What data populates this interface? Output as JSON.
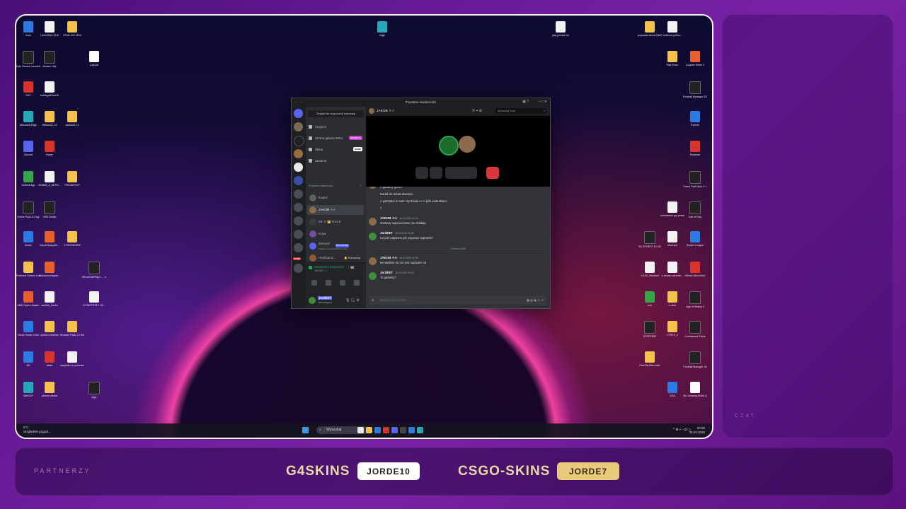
{
  "overlay": {
    "chat_label": "CZAT",
    "partners_label": "PARTNERZY",
    "partners": [
      {
        "brand": "G4SKINS",
        "code": "JORDE10",
        "pill_bg": "#ffffff",
        "pill_fg": "#222222"
      },
      {
        "brand": "CSGO-SKINS",
        "code": "JORDE7",
        "pill_bg": "#e9c97a",
        "pill_fg": "#3a2a10"
      }
    ]
  },
  "desktop": {
    "icons": [
      {
        "label": "Kosz",
        "type": "g-blue"
      },
      {
        "label": "LibreOffice 25.8",
        "type": "g-file"
      },
      {
        "label": "HTML-GO 2024",
        "type": "g-folder"
      },
      {
        "label": "edge",
        "type": "g-teal"
      },
      {
        "label": "jasy poczta me",
        "type": "g-file"
      },
      {
        "label": "poprawki strona BleSA",
        "type": "g-folder"
      },
      {
        "label": "zrobione-poliso...",
        "type": "g-file"
      },
      {
        "label": "Epic Games Launcher",
        "type": "g-dark"
      },
      {
        "label": "Mosaic Link",
        "type": "g-dark"
      },
      {
        "label": "CapCut",
        "type": "g-white"
      },
      {
        "label": "Pad Rozm",
        "type": "g-folder"
      },
      {
        "label": "Counter-Strike 2",
        "type": "g-orange"
      },
      {
        "label": "SKC",
        "type": "g-red"
      },
      {
        "label": "hostingofDirectX",
        "type": "g-file"
      },
      {
        "label": "Football Manager 2024",
        "type": "g-dark"
      },
      {
        "label": "Microsoft Edge",
        "type": "g-teal"
      },
      {
        "label": "efficiency 1.6",
        "type": "g-folder"
      },
      {
        "label": "windows 11",
        "type": "g-folder"
      },
      {
        "label": "Fortnite",
        "type": "g-blue"
      },
      {
        "label": "Discord",
        "type": "g-purple"
      },
      {
        "label": "Brave",
        "type": "g-red"
      },
      {
        "label": "Rockstar",
        "type": "g-red"
      },
      {
        "label": "NVIDIA App",
        "type": "g-green"
      },
      {
        "label": "9225B2_4_DEPO...",
        "type": "g-file"
      },
      {
        "label": "PROJEKTKP",
        "type": "g-folder"
      },
      {
        "label": "Grand Theft Auto V Legacy",
        "type": "g-dark"
      },
      {
        "label": "Online Pack S.Csgi",
        "type": "g-dark"
      },
      {
        "label": "OBS Studio",
        "type": "g-dark"
      },
      {
        "label": "Call of Duty",
        "type": "g-dark"
      },
      {
        "label": "hostowanie gry serwer",
        "type": "g-file"
      },
      {
        "label": "Steam",
        "type": "g-blue"
      },
      {
        "label": "KarperKarpyMo...",
        "type": "g-orange"
      },
      {
        "label": "ETHOSSHOW",
        "type": "g-folder"
      },
      {
        "label": "EA SPORTS FC 26",
        "type": "g-dark"
      },
      {
        "label": "efoot.pol",
        "type": "g-file"
      },
      {
        "label": "Rocket League",
        "type": "g-blue"
      },
      {
        "label": "Rockstar Games Launcher",
        "type": "g-folder"
      },
      {
        "label": "AktualnosZapyta...",
        "type": "g-orange"
      },
      {
        "label": "EthosRolePlay.n... - kopia",
        "type": "g-dark"
      },
      {
        "label": "c1102_efoot.pol",
        "type": "g-file"
      },
      {
        "label": "z-dewon-naumek...",
        "type": "g-file"
      },
      {
        "label": "Hitman Absolution",
        "type": "g-red"
      },
      {
        "label": "AMD Ryzen Master",
        "type": "g-orange"
      },
      {
        "label": "surefire_fincke",
        "type": "g-file"
      },
      {
        "label": "5.FINSTEST2 LG...",
        "type": "g-file"
      },
      {
        "label": "rme",
        "type": "g-green"
      },
      {
        "label": "c-dave",
        "type": "g-folder"
      },
      {
        "label": "Age of History 3",
        "type": "g-dark"
      },
      {
        "label": "Visual Studio Code",
        "type": "g-blue"
      },
      {
        "label": "system-vehicles",
        "type": "g-folder"
      },
      {
        "label": "Browser Pack 1.2 Beta wersja",
        "type": "g-folder"
      },
      {
        "label": "STEESS03",
        "type": "g-dark"
      },
      {
        "label": "CTRLS_2",
        "type": "g-folder"
      },
      {
        "label": "Contraband Police",
        "type": "g-dark"
      },
      {
        "label": "EA",
        "type": "g-blue"
      },
      {
        "label": "skala",
        "type": "g-red"
      },
      {
        "label": "wszystko co potrzebne ...",
        "type": "g-file"
      },
      {
        "label": "FiveObj-files-main",
        "type": "g-folder"
      },
      {
        "label": "Football Manager 26",
        "type": "g-dark"
      },
      {
        "label": "WinSCP",
        "type": "g-teal"
      },
      {
        "label": "obrone wirtice",
        "type": "g-folder"
      },
      {
        "label": "logo",
        "type": "g-dark"
      },
      {
        "label": "DSA",
        "type": "g-blue"
      },
      {
        "label": "Ski Jumping World Cup",
        "type": "g-white"
      }
    ]
  },
  "taskbar": {
    "weather_temp": "5°C",
    "weather_desc": "Względnie pogod...",
    "search_placeholder": "Wyszukaj",
    "clock_time": "20:55",
    "clock_date": "30.03.2025",
    "tray": "^  ⊕  ◐  ◁)  ▭"
  },
  "discord": {
    "window_title": "Prywatne wiadomości",
    "find_label": "Znajdź lub rozpocznij rozmowę",
    "nav": [
      {
        "label": "Znajomi"
      },
      {
        "label": "Strona główna Nitro",
        "badge": "NADZIEJA"
      },
      {
        "label": "Sklep",
        "badge": "NOWE"
      },
      {
        "label": "Zadania"
      }
    ],
    "dm_header": "Prywatne wiadomości",
    "dm_plus": "+",
    "dms": [
      {
        "name": "Kapeć",
        "color": "#5d5f66"
      },
      {
        "name": "JAKOB ✧☆",
        "color": "#8b6b4a"
      },
      {
        "name": "Mr. X 👑 HACK",
        "color": "#3a3c42"
      },
      {
        "name": "Koya",
        "color": "#7a4aa0"
      },
      {
        "name": "Discord",
        "sub": "Oficjalna wiadomość Discorda",
        "tag": "OFICJALNE",
        "color": "#5865f2"
      },
      {
        "name": "Hoolicat Z...",
        "extra": "🔔 Pomachaj",
        "color": "#8a5a3a"
      }
    ],
    "voice_status": "Nawiązano połączenie",
    "voice_sub": "JAKOB ✧☆",
    "user_name": "JordEET",
    "user_status": "Niedostępny",
    "new_badge": "NOWE",
    "chat_header_name": "JAKOB ✧☆",
    "search_placeholder": "Wyszukaj Koot",
    "messages": [
      {
        "author": "",
        "lines": [
          "A gadamy gdzie?",
          "Nadal nie działa dawanie",
          "A patrzyłeś to auto czy działa co ci pliki podesłałem",
          "?"
        ]
      },
      {
        "author": "JAKOB ✧☆",
        "time": "16.03.2026 20:44",
        "lines": [
          "Zostawy naprawczowe nie działają"
        ]
      },
      {
        "author": "JordEET",
        "time": "16.03.2026 20:48",
        "lines": [
          "Co jest napisane jak używasz naprawki?"
        ]
      },
      {
        "separator": "16 marca 2026"
      },
      {
        "author": "JAKOB ✧☆",
        "time": "16.03.2026 20:58",
        "lines": [
          "No właśnie nic nie jest napisane xd"
        ]
      },
      {
        "author": "JordEET",
        "time": "16.03.2026 20:46",
        "lines": [
          "To gadamy?"
        ]
      }
    ],
    "composer_placeholder": "Wyślij do @JAKOB ✧☆"
  }
}
